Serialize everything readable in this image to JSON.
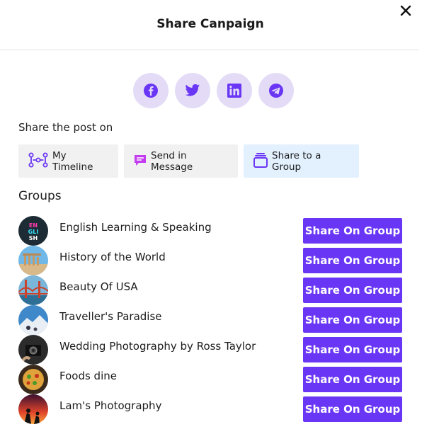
{
  "modal": {
    "title": "Share Canpaign",
    "close_icon": "close-icon"
  },
  "social_icons": [
    "facebook-icon",
    "twitter-icon",
    "linkedin-icon",
    "telegram-icon"
  ],
  "share_label": "Share the post on",
  "share_options": [
    {
      "label": "My Timeline",
      "icon": "timeline-icon",
      "active": false
    },
    {
      "label": "Send in Message",
      "icon": "message-icon",
      "active": false
    },
    {
      "label": "Share to a Group",
      "icon": "group-stack-icon",
      "active": true
    }
  ],
  "groups_label": "Groups",
  "groups": [
    {
      "name": "English Learning & Speaking",
      "button": "Share On Group",
      "avatar_text": "ENGLISH"
    },
    {
      "name": "History of the World",
      "button": "Share On Group"
    },
    {
      "name": "Beauty Of USA",
      "button": "Share On Group"
    },
    {
      "name": "Traveller's Paradise",
      "button": "Share On Group"
    },
    {
      "name": "Wedding Photography by Ross Taylor",
      "button": "Share On Group"
    },
    {
      "name": "Foods dine",
      "button": "Share On Group"
    },
    {
      "name": "Lam's Photography",
      "button": "Share On Group"
    }
  ],
  "colors": {
    "accent": "#6a36f5",
    "social_bg": "#e4dcf7",
    "social_icon": "#6a36f5",
    "active_option_bg": "#e3f1ff"
  }
}
